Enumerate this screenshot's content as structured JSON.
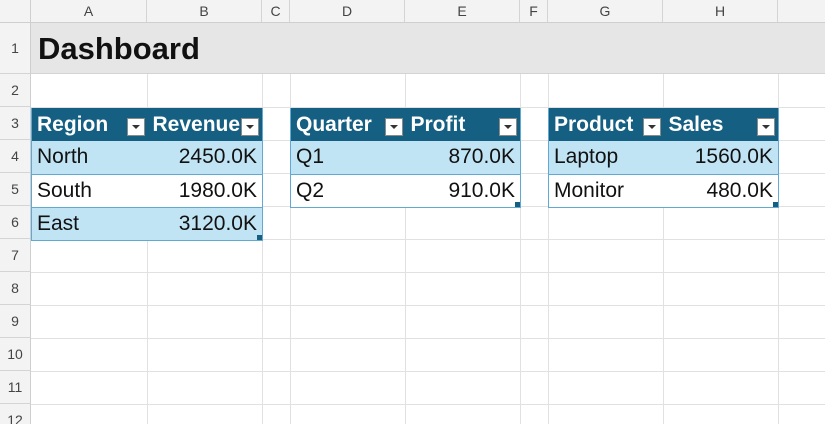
{
  "columns": [
    "A",
    "B",
    "C",
    "D",
    "E",
    "F",
    "G",
    "H"
  ],
  "rows": [
    "1",
    "2",
    "3",
    "4",
    "5",
    "6",
    "7",
    "8",
    "9",
    "10",
    "11",
    "12"
  ],
  "title": "Dashboard",
  "tables": [
    {
      "headers": [
        "Region",
        "Revenue"
      ],
      "rows": [
        [
          "North",
          "2450.0K"
        ],
        [
          "South",
          "1980.0K"
        ],
        [
          "East",
          "3120.0K"
        ]
      ]
    },
    {
      "headers": [
        "Quarter",
        "Profit"
      ],
      "rows": [
        [
          "Q1",
          "870.0K"
        ],
        [
          "Q2",
          "910.0K"
        ]
      ]
    },
    {
      "headers": [
        "Product",
        "Sales"
      ],
      "rows": [
        [
          "Laptop",
          "1560.0K"
        ],
        [
          "Monitor",
          "480.0K"
        ]
      ]
    }
  ],
  "colors": {
    "header_fill": "#155f82",
    "band_fill": "#c1e4f5",
    "title_band": "#e6e6e6"
  }
}
